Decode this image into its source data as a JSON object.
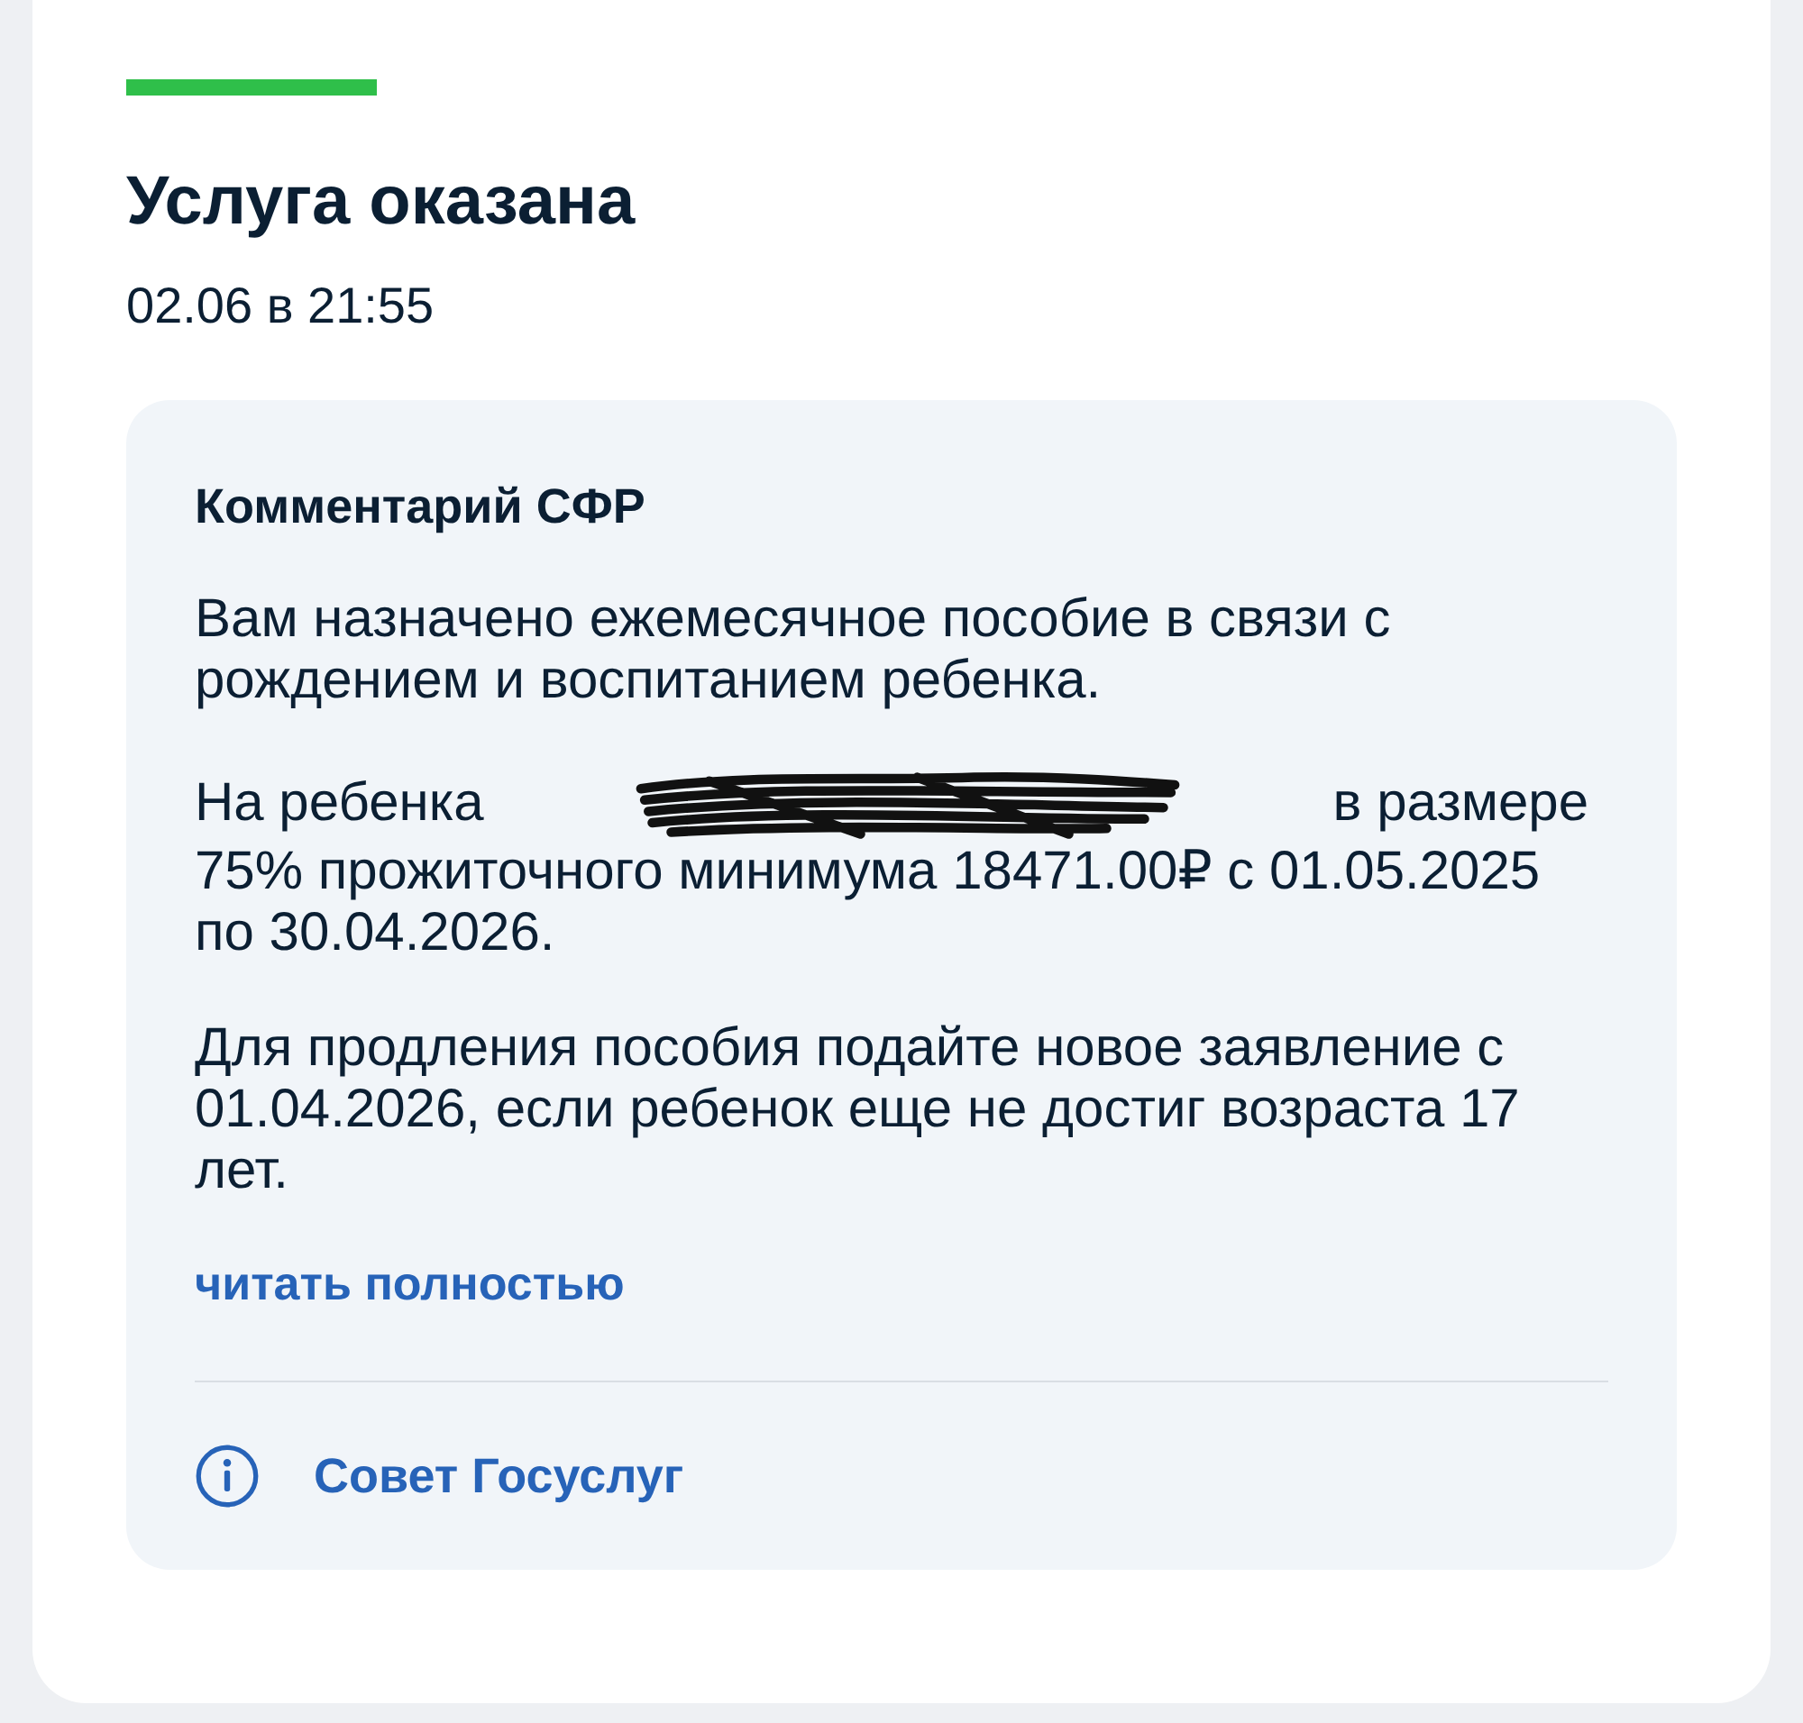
{
  "status": {
    "title": "Услуга оказана",
    "date": "02.06 в 21:55"
  },
  "comment": {
    "heading": "Комментарий СФР",
    "paragraphs": [
      {
        "segments": [
          {
            "kind": "text",
            "text": "Вам назначено ежемесячное пособие в связи с рождением и воспитанием ребенка."
          }
        ]
      },
      {
        "segments": [
          {
            "kind": "text",
            "text": "На ребенка"
          },
          {
            "kind": "redaction"
          },
          {
            "kind": "text",
            "text": "в размере"
          }
        ],
        "continuation": "75% прожиточного минимума 18471.00₽ с 01.05.2025 по 30.04.2026."
      },
      {
        "segments": [
          {
            "kind": "text",
            "text": "Для продления пособия подайте новое заявление с 01.04.2026, если ребенок еще не достиг возраста 17 лет."
          }
        ]
      }
    ],
    "read_more": "читать полностью",
    "tip": "Совет Госуслуг"
  }
}
